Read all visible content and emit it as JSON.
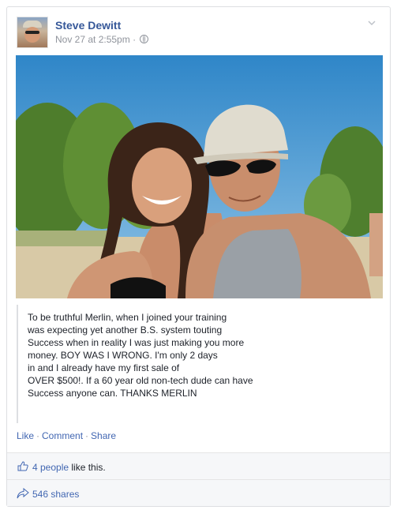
{
  "post": {
    "author": "Steve Dewitt",
    "timestamp": "Nov 27 at 2:55pm",
    "separator": "·",
    "privacy_icon": "globe-icon",
    "menu_icon": "chevron-down-icon",
    "quote_text": "To be truthful Merlin, when I joined your training\nwas expecting yet another B.S. system touting\nSuccess when in reality I was just making you more\nmoney. BOY WAS I WRONG. I'm only 2 days\nin and I already have my first sale of\nOVER $500!. If a 60 year old non-tech dude can have\nSuccess anyone can. THANKS MERLIN"
  },
  "actions": {
    "like": "Like",
    "comment": "Comment",
    "share": "Share",
    "separator": "·"
  },
  "reactions": {
    "likes_link": "4 people",
    "likes_suffix": " like this.",
    "shares": "546 shares"
  },
  "colors": {
    "link": "#4267b2",
    "name": "#365899",
    "meta": "#90949c"
  }
}
